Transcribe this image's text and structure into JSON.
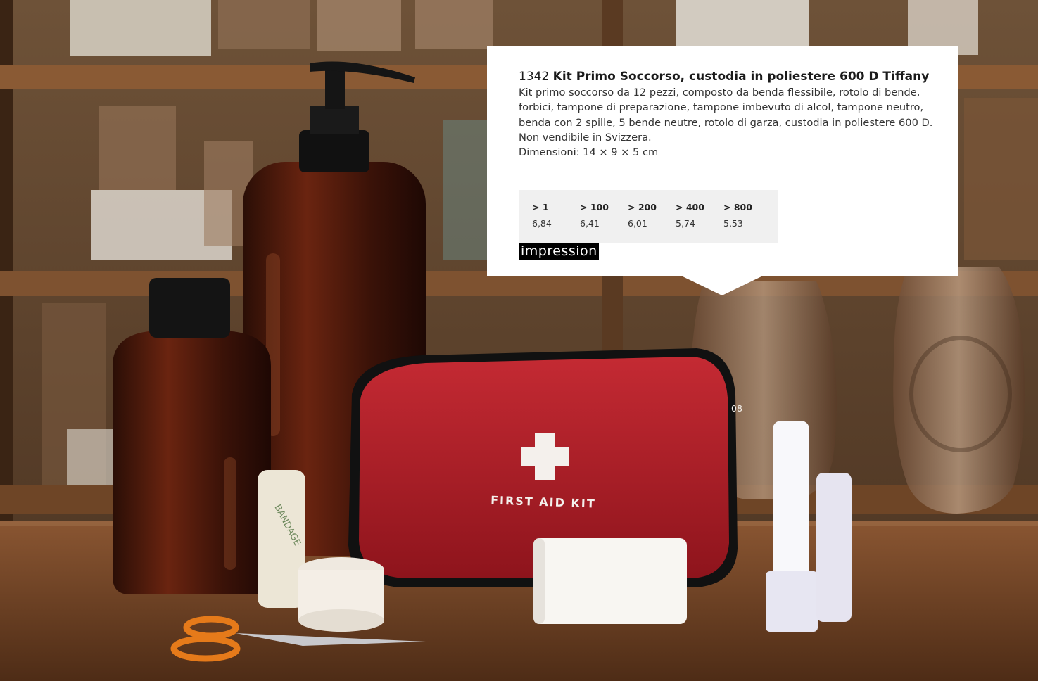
{
  "product": {
    "code": "1342",
    "name": "Kit Primo Soccorso, custodia in poliestere 600 D Tiffany",
    "description": "Kit primo soccorso da 12 pezzi, composto da benda flessibile, rotolo di bende, forbici, tampone di preparazione, tampone imbevuto di alcol, tampone neutro, benda con 2 spille, 5 bende neutre, rotolo di garza, custodia in poliestere 600 D. Non vendibile in Svizzera.",
    "dimensions": "Dimensioni: 14 × 9 × 5 cm"
  },
  "price_table": [
    {
      "qty": "> 1",
      "price": "6,84"
    },
    {
      "qty": "> 100",
      "price": "6,41"
    },
    {
      "qty": "> 200",
      "price": "6,01"
    },
    {
      "qty": "> 400",
      "price": "5,74"
    },
    {
      "qty": "> 800",
      "price": "5,53"
    }
  ],
  "brand": "impression",
  "photo": {
    "kit_label": "FIRST AID KIT",
    "bandage_text": "BANDAGE"
  },
  "page_number": "08",
  "colors": {
    "kit_red": "#b3202a",
    "shelf_wood": "#7a4b2a",
    "table_wood": "#6b3f22",
    "card_bg": "#ffffff",
    "price_bg": "#f0f0f0"
  }
}
